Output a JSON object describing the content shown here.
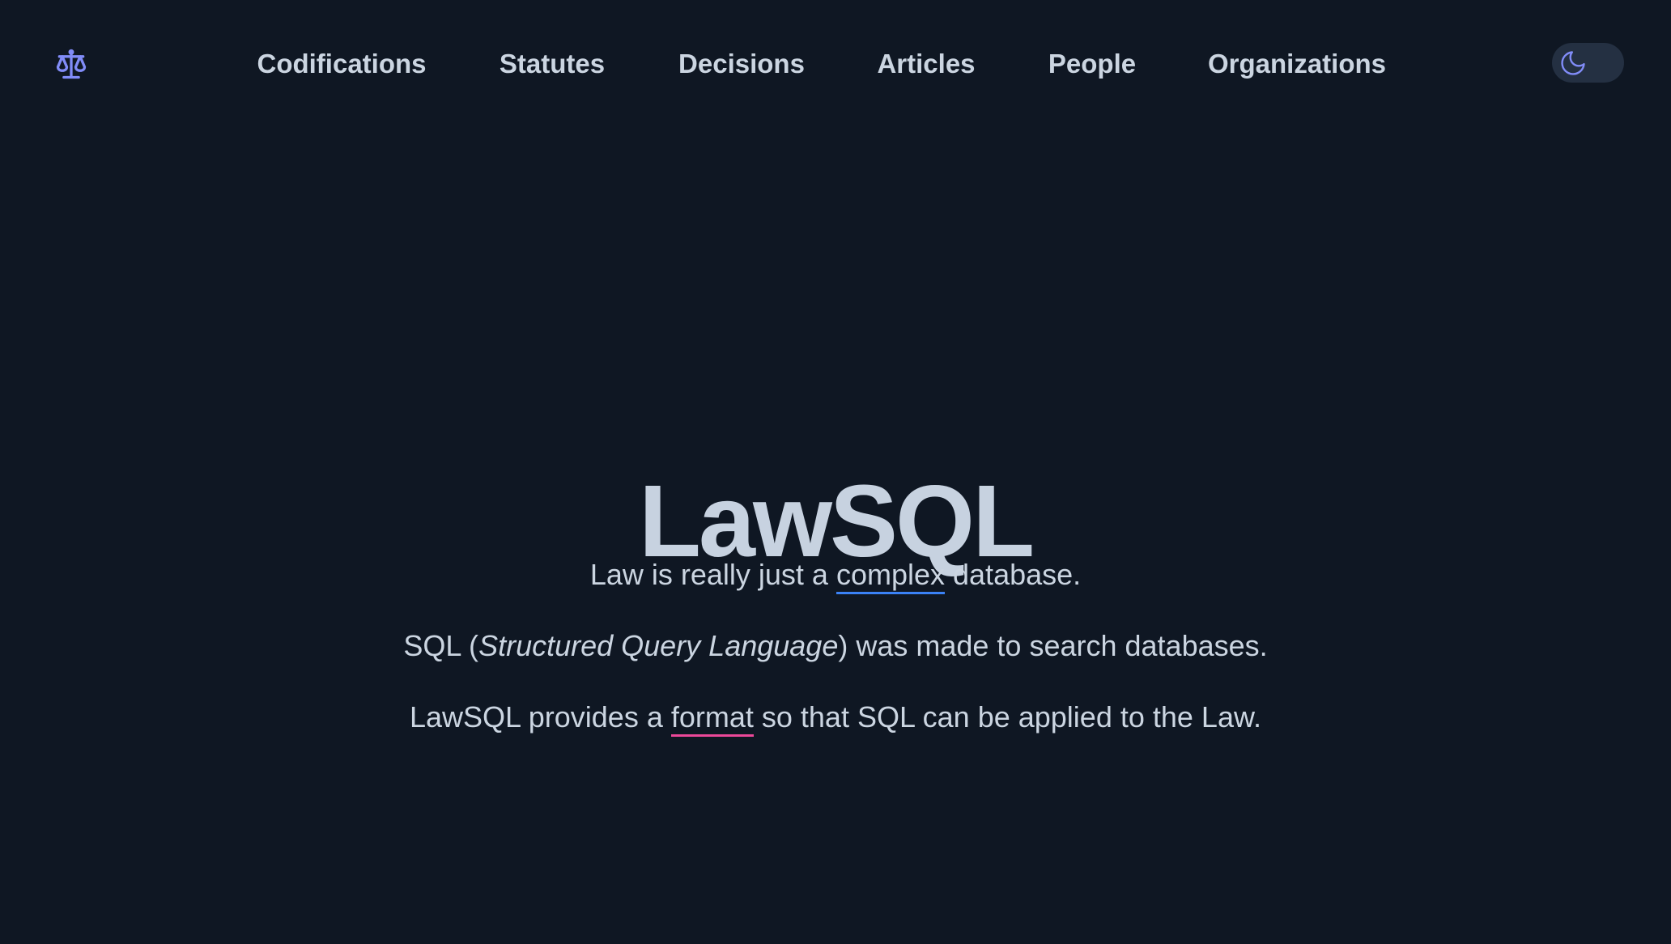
{
  "nav": {
    "items": [
      {
        "label": "Codifications"
      },
      {
        "label": "Statutes"
      },
      {
        "label": "Decisions"
      },
      {
        "label": "Articles"
      },
      {
        "label": "People"
      },
      {
        "label": "Organizations"
      }
    ]
  },
  "logo": {
    "icon": "scales-icon",
    "color": "#818cf8"
  },
  "theme_toggle": {
    "icon": "moon-icon",
    "color": "#818cf8"
  },
  "hero": {
    "title": "LawSQL",
    "line1": {
      "before": "Law is really just a ",
      "link": "complex",
      "after": " database."
    },
    "line2": {
      "before": "SQL (",
      "italic": "Structured Query Language",
      "after": ") was made to search databases."
    },
    "line3": {
      "before": "LawSQL provides a ",
      "link": "format",
      "after": " so that SQL can be applied to the Law."
    }
  },
  "colors": {
    "background": "#0f1723",
    "text": "#cbd5e1",
    "link_underline_blue": "#3b82f6",
    "link_underline_pink": "#ec4899",
    "accent": "#818cf8"
  }
}
